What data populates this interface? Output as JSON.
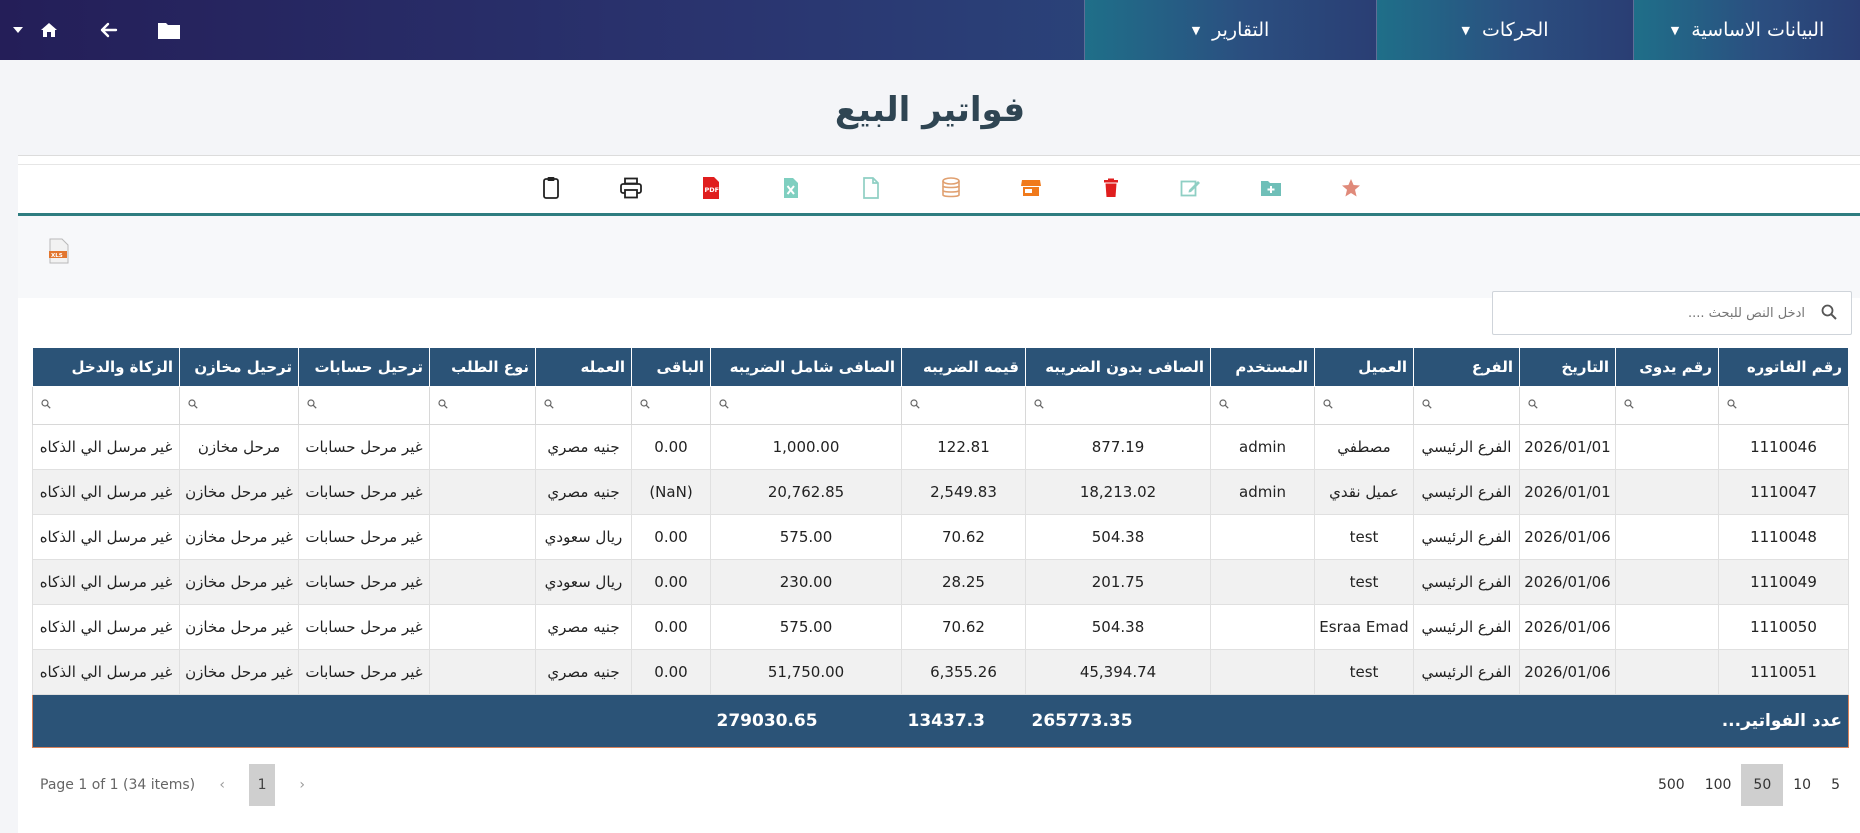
{
  "nav": {
    "menus": [
      {
        "label": "البيانات الاساسية"
      },
      {
        "label": "الحركات"
      },
      {
        "label": "التقارير"
      }
    ]
  },
  "page": {
    "title": "فواتير البيع"
  },
  "search": {
    "placeholder": "ادخل النص للبحث ...."
  },
  "grid": {
    "columns": [
      "رقم الفاتوره",
      "رقم يدوى",
      "التاريخ",
      "الفرع",
      "العميل",
      "المستخدم",
      "الصافى بدون الضريبه",
      "قيمه الضريبه",
      "الصافى شامل الضريبه",
      "الباقى",
      "العمله",
      "نوع الطلب",
      "ترحيل حسابات",
      "ترحيل مخازن",
      "الزكاة والدخل"
    ],
    "rows": [
      [
        "1110046",
        "",
        "2026/01/01",
        "الفرع الرئيسي",
        "مصطفي",
        "admin",
        "877.19",
        "122.81",
        "1,000.00",
        "0.00",
        "جنيه مصري",
        "",
        "غير مرحل حسابات",
        "مرحل مخازن",
        "غير مرسل الي الذكاه"
      ],
      [
        "1110047",
        "",
        "2026/01/01",
        "الفرع الرئيسي",
        "عميل نقدي",
        "admin",
        "18,213.02",
        "2,549.83",
        "20,762.85",
        "(NaN)",
        "جنيه مصري",
        "",
        "غير مرحل حسابات",
        "غير مرحل مخازن",
        "غير مرسل الي الذكاه"
      ],
      [
        "1110048",
        "",
        "2026/01/06",
        "الفرع الرئيسي",
        "test",
        "",
        "504.38",
        "70.62",
        "575.00",
        "0.00",
        "ريال سعودي",
        "",
        "غير مرحل حسابات",
        "غير مرحل مخازن",
        "غير مرسل الي الذكاه"
      ],
      [
        "1110049",
        "",
        "2026/01/06",
        "الفرع الرئيسي",
        "test",
        "",
        "201.75",
        "28.25",
        "230.00",
        "0.00",
        "ريال سعودي",
        "",
        "غير مرحل حسابات",
        "غير مرحل مخازن",
        "غير مرسل الي الذكاه"
      ],
      [
        "1110050",
        "",
        "2026/01/06",
        "الفرع الرئيسي",
        "Esraa Emad",
        "",
        "504.38",
        "70.62",
        "575.00",
        "0.00",
        "جنيه مصري",
        "",
        "غير مرحل حسابات",
        "غير مرحل مخازن",
        "غير مرسل الي الذكاه"
      ],
      [
        "1110051",
        "",
        "2026/01/06",
        "الفرع الرئيسي",
        "test",
        "",
        "45,394.74",
        "6,355.26",
        "51,750.00",
        "0.00",
        "جنيه مصري",
        "",
        "غير مرحل حسابات",
        "غير مرحل مخازن",
        "غير مرسل الي الذكاه"
      ]
    ],
    "footer": {
      "count_label": "عدد الفواتير...",
      "net_total": "265773.35",
      "tax_total": "13437.3",
      "gross_total": "279030.65"
    }
  },
  "pager": {
    "info": "Page 1 of 1 (34 items)",
    "current_page": "1",
    "sizes": [
      "5",
      "10",
      "50",
      "100",
      "500"
    ],
    "active_size": "50"
  },
  "colors": {
    "header": "#2b5377",
    "accent": "#2e7d80",
    "nav_start": "#241e58",
    "nav_end": "#26658a"
  },
  "toolbar_icons": [
    "favorite-star-icon",
    "add-folder-icon",
    "edit-icon",
    "delete-icon",
    "store-icon",
    "database-icon",
    "document-icon",
    "excel-icon",
    "pdf-icon",
    "print-icon",
    "clipboard-icon"
  ]
}
